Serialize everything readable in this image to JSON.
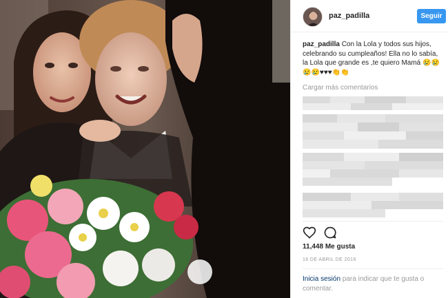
{
  "post": {
    "username": "paz_padilla",
    "follow_label": "Seguir",
    "caption_username": "paz_padilla",
    "caption_text": "Con la Lola y todos sus hijos, celebrando su cumpleaños! Ella no lo sabía, la Lola que grande es ,te quiero Mamá 😢😢 😢😢♥♥♥👏👏",
    "load_more_comments": "Cargar más comentarios",
    "likes": "11,448 Me gusta",
    "date": "16 DE ABRIL DE 2016",
    "login_link": "Inicia sesión",
    "login_rest": " para indicar que te gusta o comentar."
  },
  "icons": {
    "like": "heart-icon",
    "comment": "comment-icon"
  },
  "colors": {
    "follow_button": "#3897f0",
    "link": "#003569",
    "muted": "#999999",
    "text": "#262626"
  }
}
